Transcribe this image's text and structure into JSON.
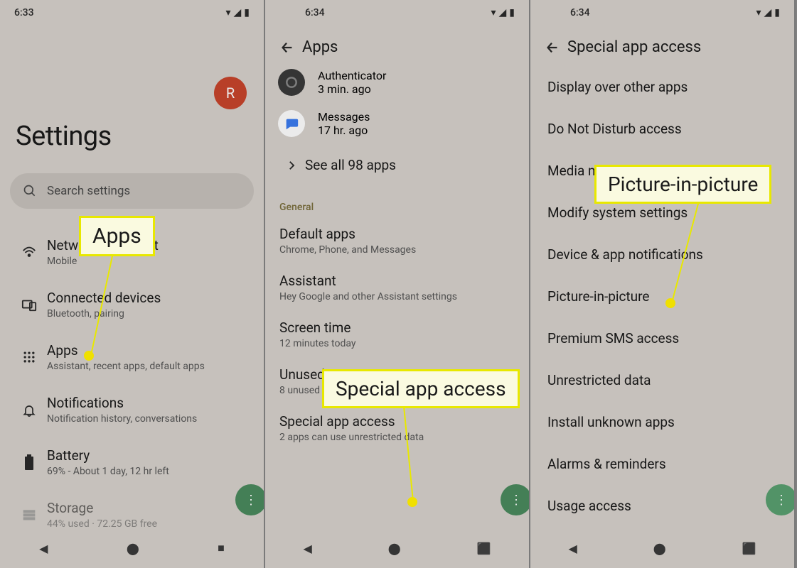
{
  "p1": {
    "status_time": "6:33",
    "avatar": "R",
    "title": "Settings",
    "search_placeholder": "Search settings",
    "rows": [
      {
        "t1": "Network & internet",
        "t2": "Mobile"
      },
      {
        "t1": "Connected devices",
        "t2": "Bluetooth, pairing"
      },
      {
        "t1": "Apps",
        "t2": "Assistant, recent apps, default apps"
      },
      {
        "t1": "Notifications",
        "t2": "Notification history, conversations"
      },
      {
        "t1": "Battery",
        "t2": "69% - About 1 day, 12 hr left"
      },
      {
        "t1": "Storage",
        "t2": "44% used · 72.25 GB free"
      }
    ],
    "callout": "Apps"
  },
  "p2": {
    "status_time": "6:34",
    "header_title": "Apps",
    "recent": [
      {
        "t1": "Authenticator",
        "t2": "3 min. ago"
      },
      {
        "t1": "Messages",
        "t2": "17 hr. ago"
      }
    ],
    "see_all": "See all 98 apps",
    "section": "General",
    "items": [
      {
        "t1": "Default apps",
        "t2": "Chrome, Phone, and Messages"
      },
      {
        "t1": "Assistant",
        "t2": "Hey Google and other Assistant settings"
      },
      {
        "t1": "Screen time",
        "t2": "12 minutes today"
      },
      {
        "t1": "Unused apps",
        "t2": "8 unused apps"
      },
      {
        "t1": "Special app access",
        "t2": "2 apps can use unrestricted data"
      }
    ],
    "callout": "Special app access"
  },
  "p3": {
    "status_time": "6:34",
    "header_title": "Special app access",
    "items": [
      "Display over other apps",
      "Do Not Disturb access",
      "Media management apps",
      "Modify system settings",
      "Device & app notifications",
      "Picture-in-picture",
      "Premium SMS access",
      "Unrestricted data",
      "Install unknown apps",
      "Alarms & reminders",
      "Usage access"
    ],
    "callout": "Picture-in-picture"
  },
  "callout_colors": {
    "border": "#e8e800",
    "bg": "#fafae0"
  }
}
